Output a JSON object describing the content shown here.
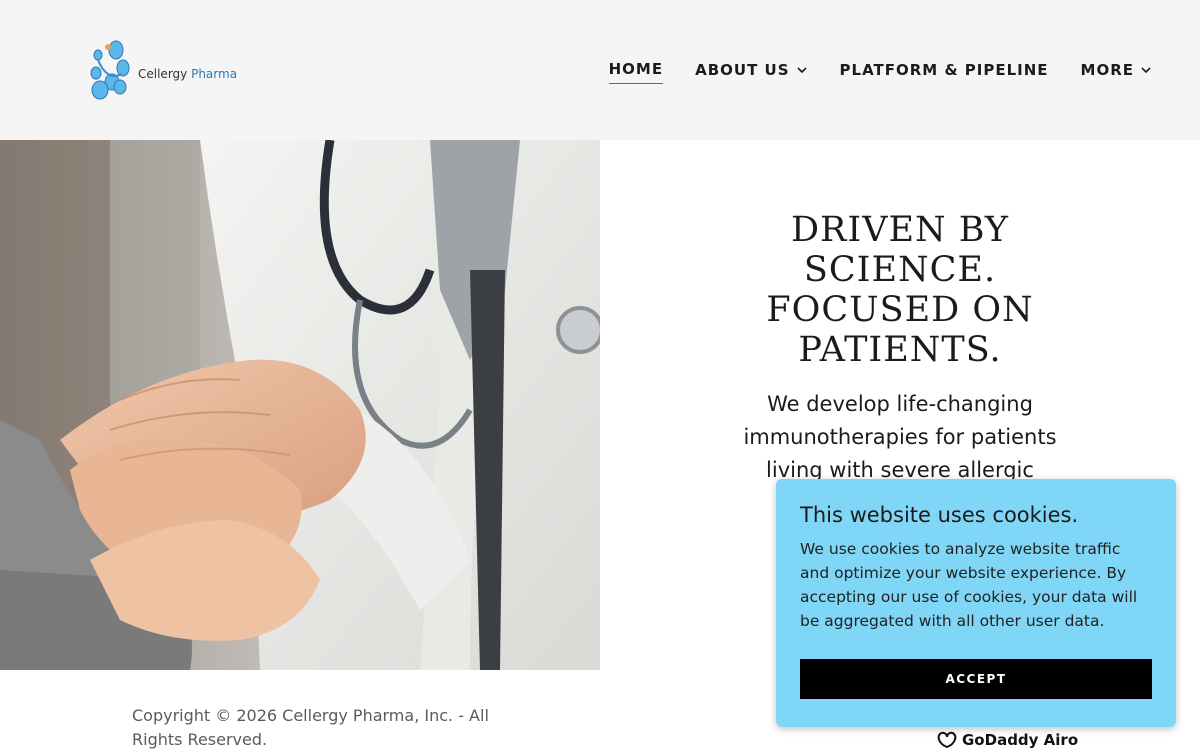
{
  "brand": {
    "name_part1": "Cellergy",
    "name_part2": "Pharma",
    "logo_icon": "molecule-logo-icon"
  },
  "nav": {
    "items": [
      {
        "label": "HOME",
        "active": true
      },
      {
        "label": "ABOUT US",
        "has_dropdown": true
      },
      {
        "label": "PLATFORM & PIPELINE"
      },
      {
        "label": "MORE",
        "has_dropdown": true
      }
    ]
  },
  "hero": {
    "image_alt_icon": "doctor-holding-patient-hands-photo",
    "title_lines": [
      "DRIVEN BY",
      "SCIENCE.",
      "FOCUSED ON",
      "PATIENTS."
    ],
    "subtitle_lines": [
      "We develop life-changing",
      "immunotherapies for patients",
      "living with severe allergic"
    ]
  },
  "footer": {
    "copyright_line1": "Copyright © 2026 Cellergy Pharma, Inc. - All",
    "copyright_line2": "Rights Reserved.",
    "powered_by": "GoDaddy Airo"
  },
  "cookie_banner": {
    "title": "This website uses cookies.",
    "body": "We use cookies to analyze website traffic and optimize your website experience. By accepting our use of cookies, your data will be aggregated with all other user data.",
    "accept_label": "ACCEPT"
  },
  "colors": {
    "header_bg": "#f5f5f5",
    "accent": "#2a78b5",
    "cookie_bg": "#80d6f7",
    "button_bg": "#000000"
  }
}
